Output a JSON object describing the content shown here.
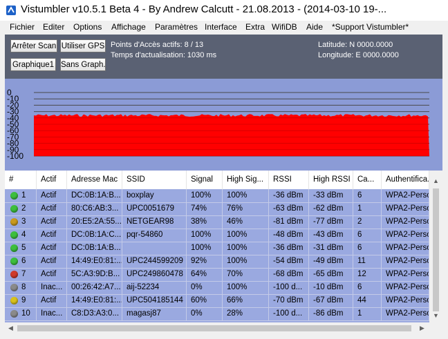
{
  "window": {
    "title": "Vistumbler v10.5.1 Beta 4 - By Andrew Calcutt - 21.08.2013 - (2014-03-10 19-..."
  },
  "menu": [
    "Fichier",
    "Editer",
    "Options",
    "Affichage",
    "Paramètres",
    "Interface",
    "Extra",
    "WifiDB",
    "Aide",
    "*Support Vistumbler*"
  ],
  "controls": {
    "stop_scan_label": "Arrêter Scan",
    "use_gps_label": "Utiliser GPS",
    "graph1_label": "Graphique1",
    "no_graph_label": "Sans Graph.",
    "active_ap_text": "Points d'Accès actifs: 8 / 13",
    "refresh_time_text": "Temps d'actualisation: 1030 ms",
    "latitude_text": "Latitude: N 0000.0000",
    "longitude_text": "Longitude: E 0000.0000"
  },
  "chart_data": {
    "type": "bar",
    "ylabels": [
      "0",
      "-10",
      "-20",
      "-30",
      "-40",
      "-50",
      "-60",
      "-70",
      "-80",
      "-90",
      "-100"
    ],
    "ylim": [
      -100,
      0
    ],
    "bar_color": "#ff0000",
    "approx_signal_level": -36
  },
  "table": {
    "columns": [
      "#",
      "Actif",
      "Adresse Mac",
      "SSID",
      "Signal",
      "High Sig...",
      "RSSI",
      "High RSSI",
      "Ca...",
      "Authentifica..."
    ],
    "rows": [
      {
        "status_color": "#3dbf3d",
        "num": "1",
        "active": "Actif",
        "mac": "DC:0B:1A:B...",
        "ssid": "boxplay",
        "signal": "100%",
        "high_signal": "100%",
        "rssi": "-36 dBm",
        "high_rssi": "-33 dBm",
        "channel": "6",
        "auth": "WPA2-Perso"
      },
      {
        "status_color": "#3dbf3d",
        "num": "2",
        "active": "Actif",
        "mac": "80:C6:AB:3...",
        "ssid": "UPC0051679",
        "signal": "74%",
        "high_signal": "76%",
        "rssi": "-63 dBm",
        "high_rssi": "-62 dBm",
        "channel": "1",
        "auth": "WPA2-Perso"
      },
      {
        "status_color": "#c99a1e",
        "num": "3",
        "active": "Actif",
        "mac": "20:E5:2A:55...",
        "ssid": "NETGEAR98",
        "signal": "38%",
        "high_signal": "46%",
        "rssi": "-81 dBm",
        "high_rssi": "-77 dBm",
        "channel": "2",
        "auth": "WPA2-Perso"
      },
      {
        "status_color": "#3dbf3d",
        "num": "4",
        "active": "Actif",
        "mac": "DC:0B:1A:C...",
        "ssid": "pqr-54860",
        "signal": "100%",
        "high_signal": "100%",
        "rssi": "-48 dBm",
        "high_rssi": "-43 dBm",
        "channel": "6",
        "auth": "WPA2-Perso"
      },
      {
        "status_color": "#3dbf3d",
        "num": "5",
        "active": "Actif",
        "mac": "DC:0B:1A:B...",
        "ssid": "",
        "signal": "100%",
        "high_signal": "100%",
        "rssi": "-36 dBm",
        "high_rssi": "-31 dBm",
        "channel": "6",
        "auth": "WPA2-Perso"
      },
      {
        "status_color": "#3dbf3d",
        "num": "6",
        "active": "Actif",
        "mac": "14:49:E0:81:...",
        "ssid": "UPC244599209",
        "signal": "92%",
        "high_signal": "100%",
        "rssi": "-54 dBm",
        "high_rssi": "-49 dBm",
        "channel": "11",
        "auth": "WPA2-Perso"
      },
      {
        "status_color": "#d03a2a",
        "num": "7",
        "active": "Actif",
        "mac": "5C:A3:9D:B...",
        "ssid": "UPC249860478",
        "signal": "64%",
        "high_signal": "70%",
        "rssi": "-68 dBm",
        "high_rssi": "-65 dBm",
        "channel": "12",
        "auth": "WPA2-Perso"
      },
      {
        "status_color": "#8a8a8a",
        "num": "8",
        "active": "Inac...",
        "mac": "00:26:42:A7...",
        "ssid": "aij-52234",
        "signal": "0%",
        "high_signal": "100%",
        "rssi": "-100 d...",
        "high_rssi": "-10 dBm",
        "channel": "6",
        "auth": "WPA2-Perso"
      },
      {
        "status_color": "#d9c21a",
        "num": "9",
        "active": "Actif",
        "mac": "14:49:E0:81:...",
        "ssid": "UPC504185144",
        "signal": "60%",
        "high_signal": "66%",
        "rssi": "-70 dBm",
        "high_rssi": "-67 dBm",
        "channel": "44",
        "auth": "WPA2-Perso"
      },
      {
        "status_color": "#8a8a8a",
        "num": "10",
        "active": "Inac...",
        "mac": "C8:D3:A3:0...",
        "ssid": "magasj87",
        "signal": "0%",
        "high_signal": "28%",
        "rssi": "-100 d...",
        "high_rssi": "-86 dBm",
        "channel": "1",
        "auth": "WPA2-Perso"
      }
    ]
  }
}
